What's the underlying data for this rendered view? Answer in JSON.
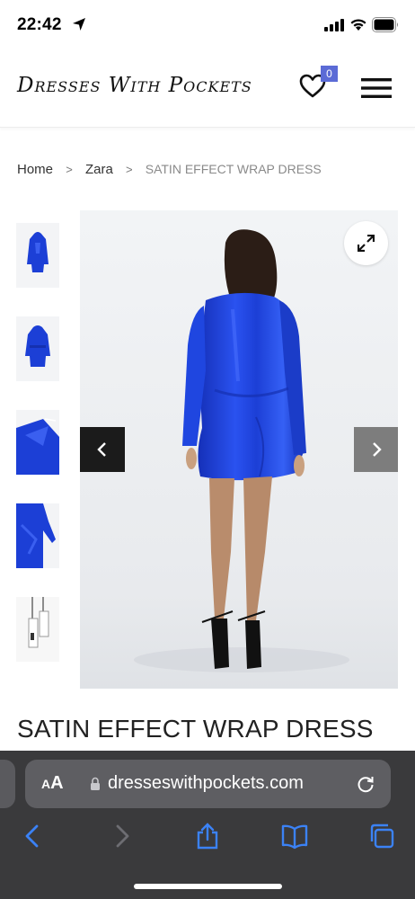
{
  "status_bar": {
    "time": "22:42"
  },
  "header": {
    "logo": "Dresses With Pockets",
    "wishlist_count": "0"
  },
  "breadcrumb": {
    "items": [
      "Home",
      "Zara",
      "SATIN EFFECT WRAP DRESS"
    ],
    "separator": ">"
  },
  "gallery": {
    "thumbnail_count": 5,
    "selected_thumbnail": 1
  },
  "product": {
    "title": "SATIN EFFECT WRAP DRESS"
  },
  "browser": {
    "aa_label_big": "A",
    "aa_label_small": "A",
    "url": "dresseswithpockets.com"
  },
  "colors": {
    "dress_blue": "#1c3fd6",
    "badge": "#5b6bd6",
    "toolbar_icons": "#3b82f6",
    "safari_bar": "#3a3a3c"
  },
  "icons": [
    "location-arrow-icon",
    "signal-icon",
    "wifi-icon",
    "battery-icon",
    "heart-icon",
    "hamburger-menu-icon",
    "expand-icon",
    "chevron-left-icon",
    "chevron-right-icon",
    "lock-icon",
    "reload-icon",
    "back-icon",
    "forward-icon",
    "share-icon",
    "bookmarks-icon",
    "tabs-icon"
  ]
}
